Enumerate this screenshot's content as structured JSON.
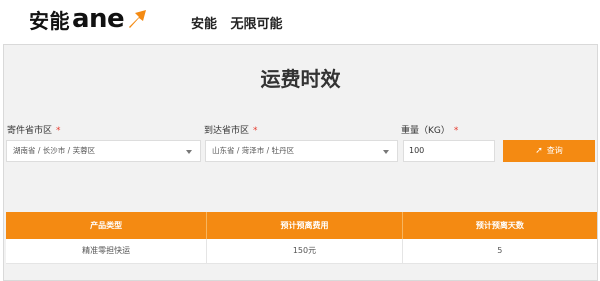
{
  "header": {
    "logo_cn": "安能",
    "logo_en": "ane",
    "slogan_1": "安能",
    "slogan_2": "无限可能"
  },
  "page": {
    "title": "运费时效"
  },
  "form": {
    "sender_label": "寄件省市区",
    "sender_value": "湖南省 / 长沙市 / 芙蓉区",
    "receiver_label": "到达省市区",
    "receiver_value": "山东省 / 菏泽市 / 牡丹区",
    "weight_label": "重量（KG）",
    "weight_value": "100",
    "required_mark": "*",
    "query_label": "查询"
  },
  "table": {
    "headers": [
      "产品类型",
      "预计预离费用",
      "预计预离天数"
    ],
    "rows": [
      [
        "精准零担快运",
        "150元",
        "5"
      ]
    ]
  },
  "colors": {
    "accent": "#f48a12",
    "required": "#e63b2e"
  }
}
